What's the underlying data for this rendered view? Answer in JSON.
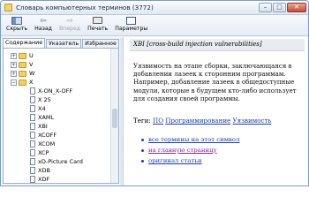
{
  "window": {
    "title": "Словарь компьютерных терминов (3772)",
    "controls": {
      "minimize": "–",
      "maximize": "□",
      "close": "✕"
    }
  },
  "toolbar": {
    "hide": "Скрыть",
    "back": "Назад",
    "forward": "Вперед",
    "print": "Печать",
    "options": "Параметры",
    "back_icon": "⇦",
    "forward_icon": "⇨"
  },
  "tabs": [
    "Содержание",
    "Указатель",
    "Избранное"
  ],
  "tree": {
    "items": [
      {
        "label": "U",
        "type": "folder",
        "expander": "+"
      },
      {
        "label": "V",
        "type": "folder",
        "expander": "+"
      },
      {
        "label": "W",
        "type": "folder",
        "expander": "+"
      },
      {
        "label": "X",
        "type": "folder",
        "expander": "−"
      },
      {
        "label": "X-ON_X-OFF",
        "type": "doc"
      },
      {
        "label": "X 25",
        "type": "doc"
      },
      {
        "label": "X4",
        "type": "doc"
      },
      {
        "label": "XAML",
        "type": "doc"
      },
      {
        "label": "XBI",
        "type": "doc"
      },
      {
        "label": "XCOFF",
        "type": "doc"
      },
      {
        "label": "XCOM",
        "type": "doc"
      },
      {
        "label": "XCP",
        "type": "doc"
      },
      {
        "label": "xD-Picture Card",
        "type": "doc"
      },
      {
        "label": "XDB",
        "type": "doc"
      },
      {
        "label": "XDF",
        "type": "doc"
      }
    ]
  },
  "article": {
    "heading": "XBI [cross-build injection vulnerabilities]",
    "paragraph": "Уязвимость на этапе сборки, заключающаяся в добавлении лазеек к сторонним программам. Например, добавление лазеек в общедоступные модули, которые в будущем кто-либо использует для создания своей программы.",
    "tags_label": "Теги:",
    "tags": [
      "ПО",
      "Программирование",
      "Уязвимость"
    ],
    "links": [
      {
        "label": "все термины на этот символ",
        "visited": false
      },
      {
        "label": "на главную страницу",
        "visited": true
      },
      {
        "label": "оригинал статьи",
        "visited": false
      }
    ]
  }
}
